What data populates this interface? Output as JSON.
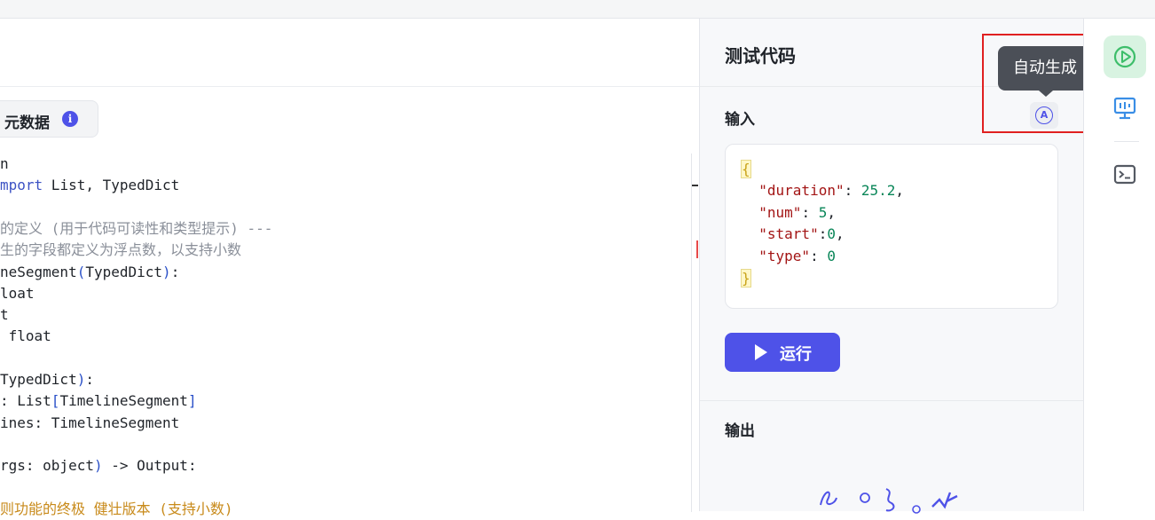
{
  "editor": {
    "metadata_label": "元数据",
    "info_icon": "i",
    "code_lines": [
      {
        "parts": [
          {
            "t": "n",
            "c": ""
          }
        ]
      },
      {
        "parts": [
          {
            "t": "mport",
            "c": "kw"
          },
          {
            "t": " List, TypedDict",
            "c": ""
          }
        ]
      },
      {
        "parts": [
          {
            "t": "",
            "c": ""
          }
        ]
      },
      {
        "parts": [
          {
            "t": "的定义 (用于代码可读性和类型提示) ---",
            "c": "cm"
          }
        ]
      },
      {
        "parts": [
          {
            "t": "生的字段都定义为浮点数，以支持小数",
            "c": "cm"
          }
        ]
      },
      {
        "parts": [
          {
            "t": "neSegment",
            "c": ""
          },
          {
            "t": "(",
            "c": "br"
          },
          {
            "t": "TypedDict",
            "c": ""
          },
          {
            "t": ")",
            "c": "br"
          },
          {
            "t": ":",
            "c": ""
          }
        ]
      },
      {
        "parts": [
          {
            "t": "loat",
            "c": ""
          }
        ]
      },
      {
        "parts": [
          {
            "t": "t",
            "c": ""
          }
        ]
      },
      {
        "parts": [
          {
            "t": " float",
            "c": ""
          }
        ]
      },
      {
        "parts": [
          {
            "t": "",
            "c": ""
          }
        ]
      },
      {
        "parts": [
          {
            "t": "TypedDict",
            "c": ""
          },
          {
            "t": ")",
            "c": "br"
          },
          {
            "t": ":",
            "c": ""
          }
        ]
      },
      {
        "parts": [
          {
            "t": ": List",
            "c": ""
          },
          {
            "t": "[",
            "c": "br"
          },
          {
            "t": "TimelineSegment",
            "c": ""
          },
          {
            "t": "]",
            "c": "br"
          }
        ]
      },
      {
        "parts": [
          {
            "t": "ines: TimelineSegment",
            "c": ""
          }
        ]
      },
      {
        "parts": [
          {
            "t": "",
            "c": ""
          }
        ]
      },
      {
        "parts": [
          {
            "t": "rgs: object",
            "c": ""
          },
          {
            "t": ")",
            "c": "br"
          },
          {
            "t": " -> Output:",
            "c": ""
          }
        ]
      },
      {
        "parts": [
          {
            "t": "",
            "c": ""
          }
        ]
      },
      {
        "parts": [
          {
            "t": "则功能的终极 健壮版本 (支持小数)",
            "c": "or"
          }
        ]
      }
    ]
  },
  "panel": {
    "title": "测试代码",
    "input_label": "输入",
    "auto_generate_icon": "A",
    "json_input": {
      "open": "{",
      "close": "}",
      "entries": [
        {
          "key": "\"duration\"",
          "sep": ": ",
          "value": "25.2",
          "tail": ","
        },
        {
          "key": "\"num\"",
          "sep": ": ",
          "value": "5",
          "tail": ","
        },
        {
          "key": "\"start\"",
          "sep": ":",
          "value": "0",
          "tail": ","
        },
        {
          "key": "\"type\"",
          "sep": ": ",
          "value": "0",
          "tail": ""
        }
      ]
    },
    "run_button": "运行",
    "output_label": "输出"
  },
  "tooltip": {
    "text": "自动生成"
  },
  "toolbar": {
    "accent_active": "#3dbe6a",
    "items": [
      "play-circle-icon",
      "monitor-icon",
      "terminal-icon"
    ]
  },
  "colors": {
    "primary": "#4e52e8",
    "highlight": "#e02020"
  }
}
